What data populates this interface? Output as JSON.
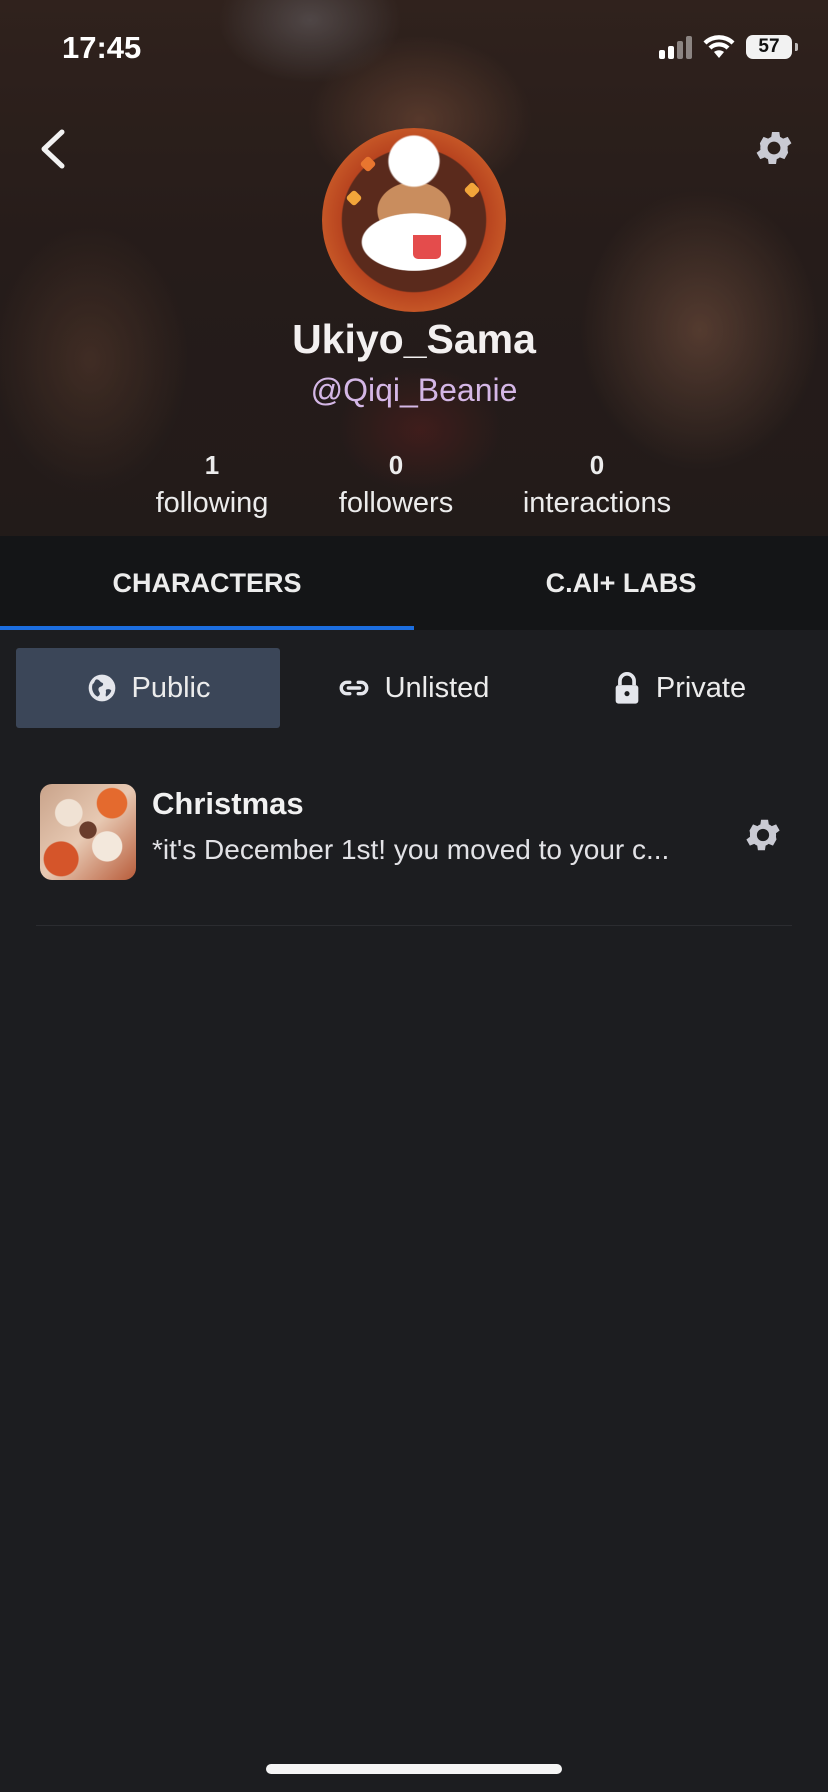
{
  "status_bar": {
    "time": "17:45",
    "battery": "57"
  },
  "profile": {
    "display_name": "Ukiyo_Sama",
    "handle": "@Qiqi_Beanie",
    "stats": [
      {
        "value": "1",
        "label": "following"
      },
      {
        "value": "0",
        "label": "followers"
      },
      {
        "value": "0",
        "label": "interactions"
      }
    ]
  },
  "tabs": [
    {
      "label": "CHARACTERS",
      "active": true
    },
    {
      "label": "C.AI+ LABS",
      "active": false
    }
  ],
  "filters": [
    {
      "label": "Public",
      "icon": "globe-icon",
      "active": true
    },
    {
      "label": "Unlisted",
      "icon": "link-icon",
      "active": false
    },
    {
      "label": "Private",
      "icon": "lock-icon",
      "active": false
    }
  ],
  "characters": [
    {
      "name": "Christmas",
      "description": "*it's December 1st! you moved to your c..."
    }
  ],
  "colors": {
    "accent": "#1c6ee0",
    "handle": "#d4b7e6",
    "active_filter": "#3b4658",
    "background": "#1c1d20"
  }
}
